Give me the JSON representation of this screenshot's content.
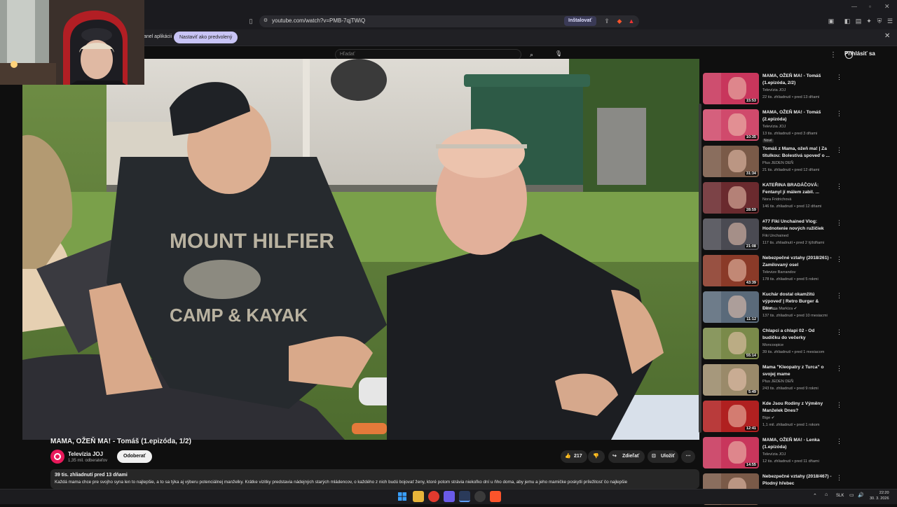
{
  "browser": {
    "url": "youtube.com/watch?v=PMB-7qjTWiQ",
    "install_label": "Inštalovať",
    "infobar_text": "anel aplikácii",
    "infobar_button": "Nastaviť ako predvolený",
    "close_glyph": "✕"
  },
  "header": {
    "search_placeholder": "Hľadať",
    "signin_label": "Prihlásiť sa",
    "more_glyph": "⋮"
  },
  "video": {
    "title": "MAMA, OŽEŇ MA! - Tomáš (1.epizóda, 1/2)",
    "channel": "Televízia JOJ",
    "subscribers": "1,35 mil. odberateľov",
    "subscribe_label": "Odoberať",
    "likes": "217",
    "share_label": "Zdieľať",
    "save_label": "Uložiť",
    "more_glyph": "⋯",
    "desc_meta": "39 tis. zhliadnutí  pred 13 dňami",
    "description": "Každá mama chce pre svojho syna len to najlepšie, a to sa týka aj výberu potenciálnej manželky. Krátke vizitky predstavia nádejných starých mládencov, o každého z nich budú bojovať ženy, ktoré potom strávia niekoľko dní u ňho doma, aby jemu a jeho mamičke poskytli príležitosť čo najlepšie"
  },
  "sidebar": {
    "items": [
      {
        "title": "MAMA, OŽEŇ MA! - Tomáš (1.epizóda, 2/2)",
        "channel": "Televízia JOJ",
        "meta": "22 tis. zhliadnutí • pred 13 dňami",
        "duration": "15:53",
        "badge": "",
        "thumb": "#c8365c"
      },
      {
        "title": "MAMA, OŽEŇ MA! - Tomáš (2.epizóda)",
        "channel": "Televízia JOJ",
        "meta": "13 tis. zhliadnutí • pred 3 dňami",
        "duration": "10:35",
        "badge": "Nové",
        "thumb": "#d04a6c"
      },
      {
        "title": "Tomáš z Mama, ožeň ma! | Za titulkou: Bolestivá spoveď o ...",
        "channel": "Plus JEDEN DEŇ",
        "meta": "21 tis. zhliadnutí • pred 12 dňami",
        "duration": "31:34",
        "badge": "",
        "thumb": "#7a5a48"
      },
      {
        "title": "KATEŘINA BRADÁČOVÁ: Fentanyl jí málem zabil. ...",
        "channel": "Nora Fridrichová",
        "meta": "146 tis. zhliadnutí • pred 12 dňami",
        "duration": "28:59",
        "badge": "",
        "thumb": "#6a2a2e"
      },
      {
        "title": "#77 Fiki Unchained Vlog: Hodnotenie nových ružičiek",
        "channel": "Fiki Unchained",
        "meta": "117 tis. zhliadnutí • pred 2 týždňami",
        "duration": "21:08",
        "badge": "",
        "thumb": "#4a4a52"
      },
      {
        "title": "Nebezpečné vztahy (2018/261) - Zamilovaný osel",
        "channel": "Televize Barrandov",
        "meta": "178 tis. zhliadnutí • pred 5 rokmi",
        "duration": "43:39",
        "badge": "",
        "thumb": "#8a3a28"
      },
      {
        "title": "Kuchár dostal okamžitú výpoveď | Retro Burger & Dinn...",
        "channel": "Televízia Markíza ✔",
        "meta": "137 tis. zhliadnutí • pred 10 mesiacmi",
        "duration": "11:12",
        "badge": "",
        "thumb": "#5a6a7a"
      },
      {
        "title": "Chlapci a chlapi 02 - Od budíčku do večerky",
        "channel": "Moncoopice",
        "meta": "39 tis. zhliadnutí • pred 1 mesiacom",
        "duration": "55:14",
        "badge": "",
        "thumb": "#7a8a4a"
      },
      {
        "title": "Mama \"Kleopatry z Turca\" o svojej mame",
        "channel": "Plus JEDEN DEŇ",
        "meta": "243 tis. zhliadnutí • pred 9 rokmi",
        "duration": "5:49",
        "badge": "",
        "thumb": "#9a8a6a"
      },
      {
        "title": "Kde Jsou Rodiny z Výměny Manželek Dnes?",
        "channel": "Bige ✔",
        "meta": "1,1 mil. zhliadnutí • pred 1 rokom",
        "duration": "12:41",
        "badge": "",
        "thumb": "#b02020"
      },
      {
        "title": "MAMA, OŽEŇ MA! - Lenka (1.epizóda)",
        "channel": "Televízia JOJ",
        "meta": "12 tis. zhliadnutí • pred 11 dňami",
        "duration": "14:55",
        "badge": "",
        "thumb": "#c8365c"
      },
      {
        "title": "Nebezpečné vztahy (2018/467) - Plodný hřebec",
        "channel": "Televize Barrandov",
        "meta": "",
        "duration": "",
        "badge": "",
        "thumb": "#7a5a48"
      }
    ]
  },
  "taskbar": {
    "lang": "SLK",
    "time": "22:20",
    "date": "30. 3. 2026"
  },
  "colors": {
    "accent": "#3ea6ff",
    "joj_red": "#e8195a",
    "youtube_red": "#ff0000"
  }
}
